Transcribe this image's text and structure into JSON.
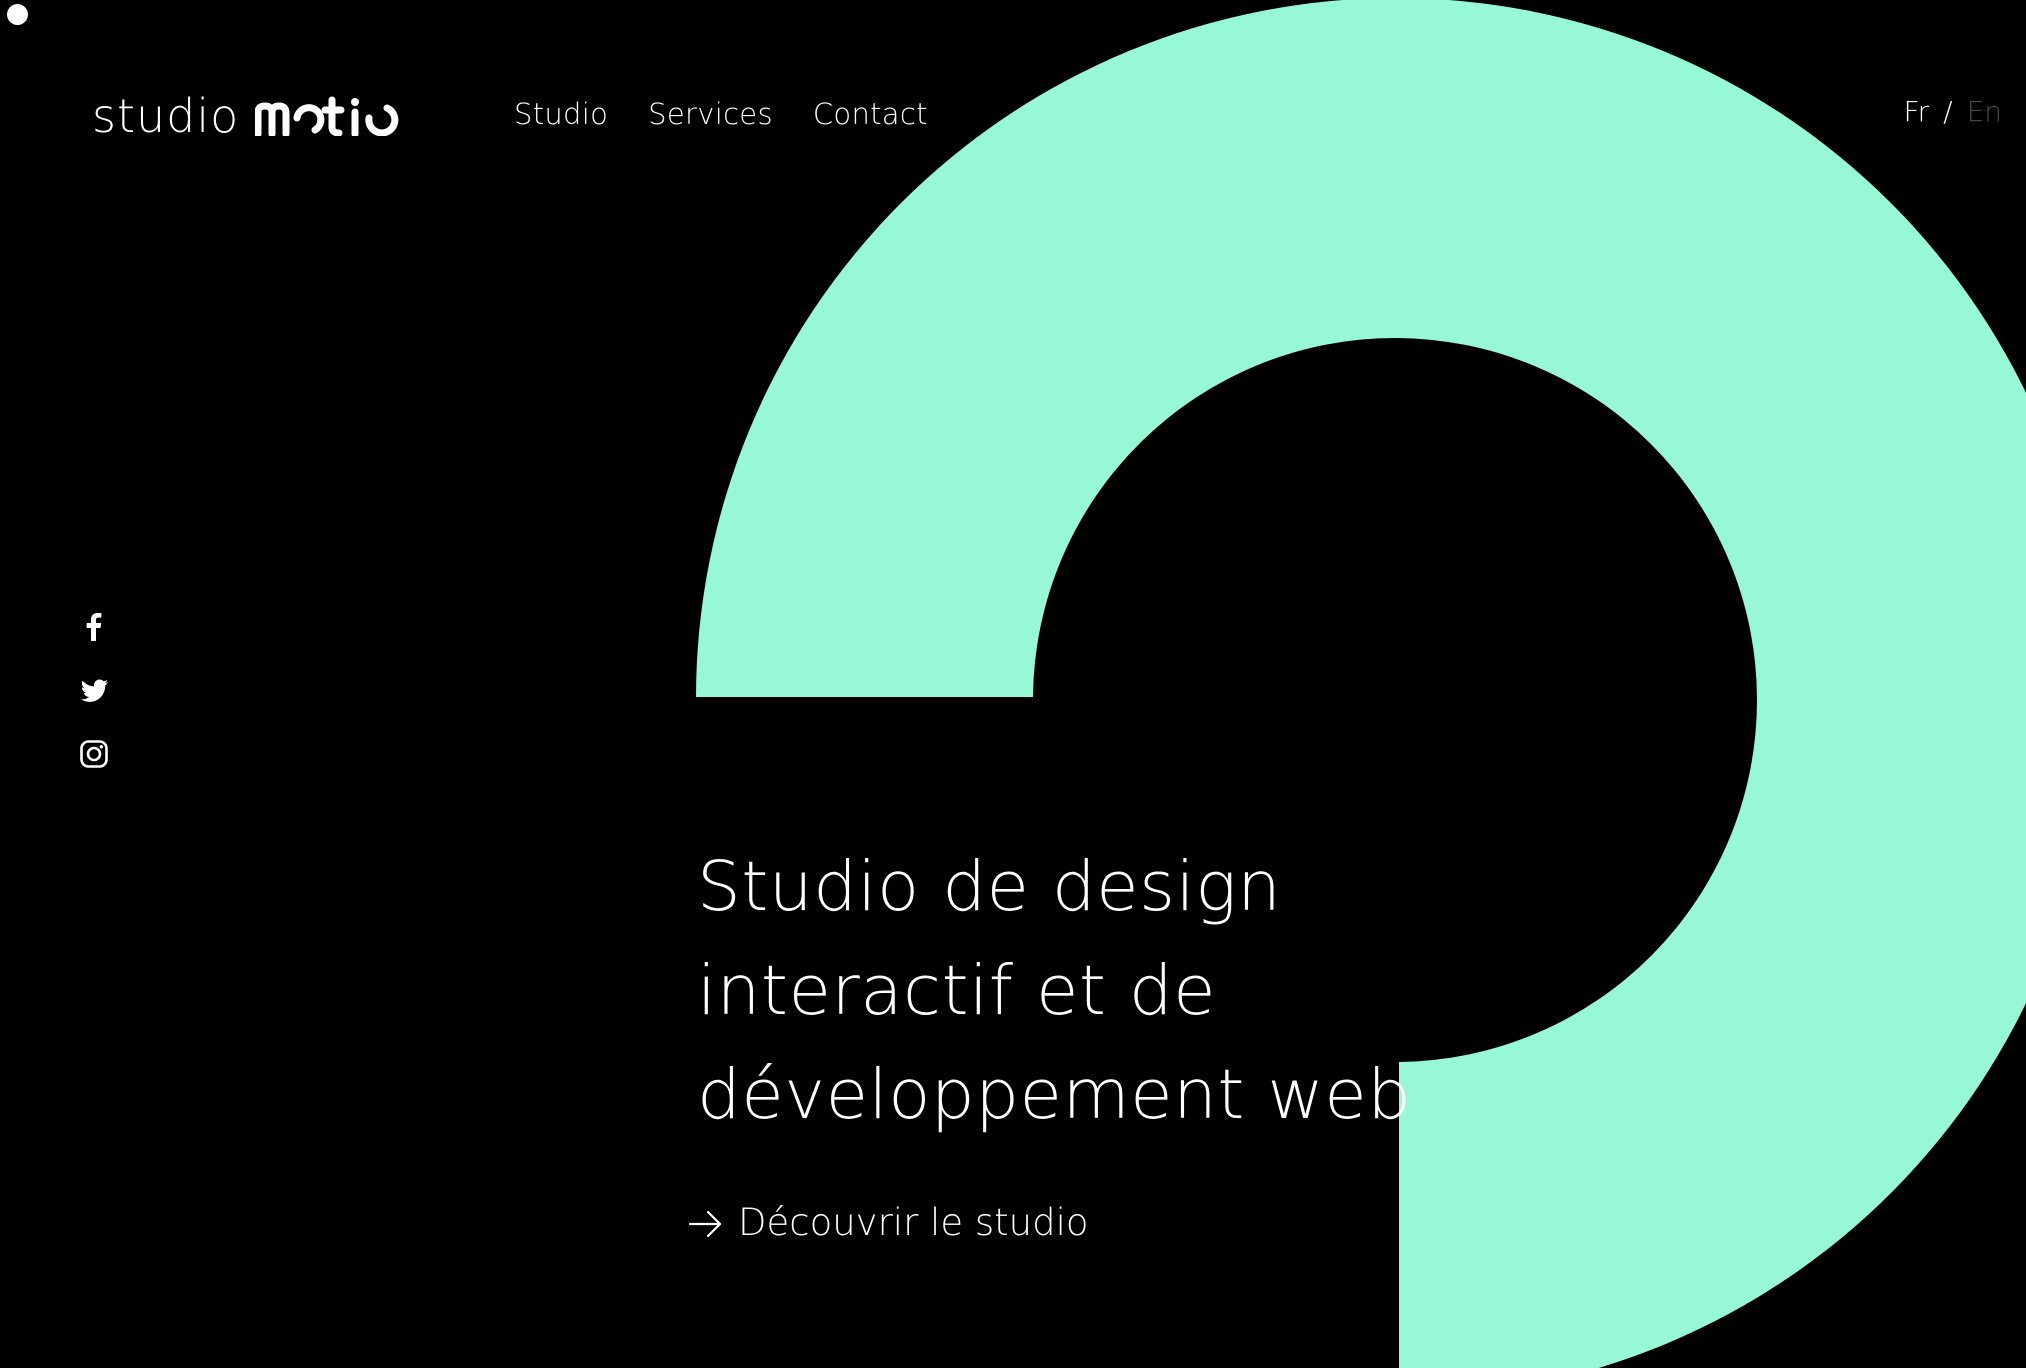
{
  "brand": {
    "logo_word": "studio",
    "logo_mark": "motio",
    "accent_color": "#96F8D6",
    "background_color": "#000000"
  },
  "nav": {
    "items": [
      {
        "label": "Studio"
      },
      {
        "label": "Services"
      },
      {
        "label": "Contact"
      }
    ]
  },
  "language": {
    "fr": "Fr",
    "separator": "/",
    "en": "En",
    "active": "Fr"
  },
  "social": {
    "items": [
      {
        "icon": "facebook-icon"
      },
      {
        "icon": "twitter-icon"
      },
      {
        "icon": "instagram-icon"
      }
    ]
  },
  "hero": {
    "title_lines": [
      "Studio de design",
      "interactif et de",
      "développement web"
    ],
    "cta_label": "Découvrir le studio",
    "cta_icon": "arrow-right-icon"
  }
}
